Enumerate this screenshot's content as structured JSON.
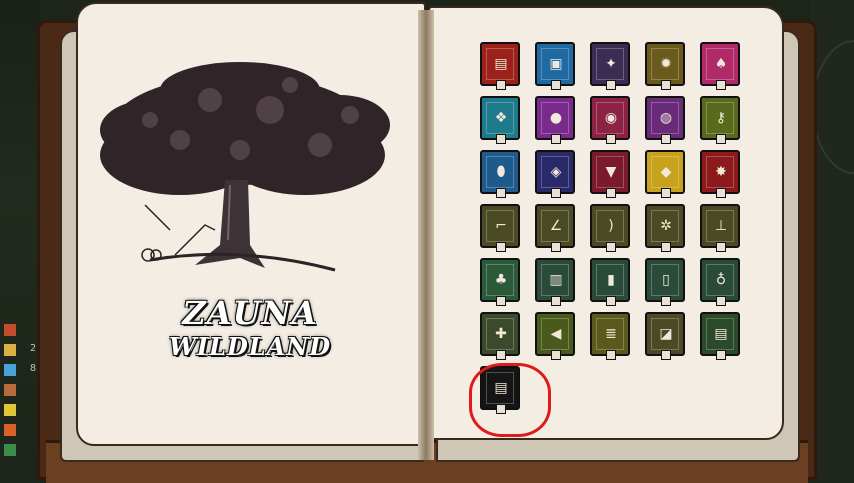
{
  "book": {
    "title_line1": "ZAUNA",
    "title_line2": "WILDLAND"
  },
  "colors": {
    "cover": "#4a2a17",
    "page": "#f3ede3",
    "highlight": "#e01a1a"
  },
  "hud": [
    {
      "color": "#c44b2b",
      "text": ""
    },
    {
      "color": "#d8b341",
      "text": "2"
    },
    {
      "color": "#4aa3d8",
      "text": "8"
    },
    {
      "color": "#b86a3b",
      "text": ""
    },
    {
      "color": "#e0c73a",
      "text": ""
    },
    {
      "color": "#d9622b",
      "text": ""
    },
    {
      "color": "#3d8c4a",
      "text": ""
    }
  ],
  "tiles": [
    {
      "name": "red-scroll",
      "color": "#9c2219",
      "glyph": "▤"
    },
    {
      "name": "blue-totem",
      "color": "#1f6aa3",
      "glyph": "▣"
    },
    {
      "name": "purple-crystal",
      "color": "#3a2c52",
      "glyph": "✦"
    },
    {
      "name": "gear",
      "color": "#6a5a1c",
      "glyph": "✹"
    },
    {
      "name": "pink-creature",
      "color": "#b02a6a",
      "glyph": "♠"
    },
    {
      "name": "cyan-rune",
      "color": "#1f7a8c",
      "glyph": "❖"
    },
    {
      "name": "violet-orb",
      "color": "#7a2a8c",
      "glyph": "●"
    },
    {
      "name": "magenta-eye",
      "color": "#8c2244",
      "glyph": "◉"
    },
    {
      "name": "violet-lamp",
      "color": "#6a2a7a",
      "glyph": "◍"
    },
    {
      "name": "yellow-key",
      "color": "#5a6a1c",
      "glyph": "⚷"
    },
    {
      "name": "blue-nut",
      "color": "#1f5a8c",
      "glyph": "⬮"
    },
    {
      "name": "navy-potion",
      "color": "#2a2a6a",
      "glyph": "◈"
    },
    {
      "name": "crimson-chalice",
      "color": "#7a1a2a",
      "glyph": "▼"
    },
    {
      "name": "yellow-gem",
      "color": "#c8a21c",
      "glyph": "◆"
    },
    {
      "name": "red-flame",
      "color": "#8c1a1a",
      "glyph": "✸"
    },
    {
      "name": "pickaxe",
      "color": "#4a4a24",
      "glyph": "⌐"
    },
    {
      "name": "scythe",
      "color": "#4a4a24",
      "glyph": "∠"
    },
    {
      "name": "bow",
      "color": "#4a4a24",
      "glyph": ")"
    },
    {
      "name": "branch",
      "color": "#4a4a24",
      "glyph": "✲"
    },
    {
      "name": "axe",
      "color": "#4a4a24",
      "glyph": "⊥"
    },
    {
      "name": "green-plant",
      "color": "#2a5a3a",
      "glyph": "♣"
    },
    {
      "name": "stove",
      "color": "#2a4a3a",
      "glyph": "▥"
    },
    {
      "name": "cleaver",
      "color": "#2a4a3a",
      "glyph": "▮"
    },
    {
      "name": "jar",
      "color": "#2a4a3a",
      "glyph": "▯"
    },
    {
      "name": "flask",
      "color": "#2a4a3a",
      "glyph": "♁"
    },
    {
      "name": "sword-charm",
      "color": "#3a4a2a",
      "glyph": "✚"
    },
    {
      "name": "horn",
      "color": "#4a5a1c",
      "glyph": "◀"
    },
    {
      "name": "parchment",
      "color": "#5a5a1c",
      "glyph": "≣"
    },
    {
      "name": "eraser",
      "color": "#4a4a24",
      "glyph": "◪"
    },
    {
      "name": "green-barrel",
      "color": "#2a4a2a",
      "glyph": "▤"
    },
    {
      "name": "black-scroll",
      "color": "#151515",
      "glyph": "▤"
    }
  ]
}
